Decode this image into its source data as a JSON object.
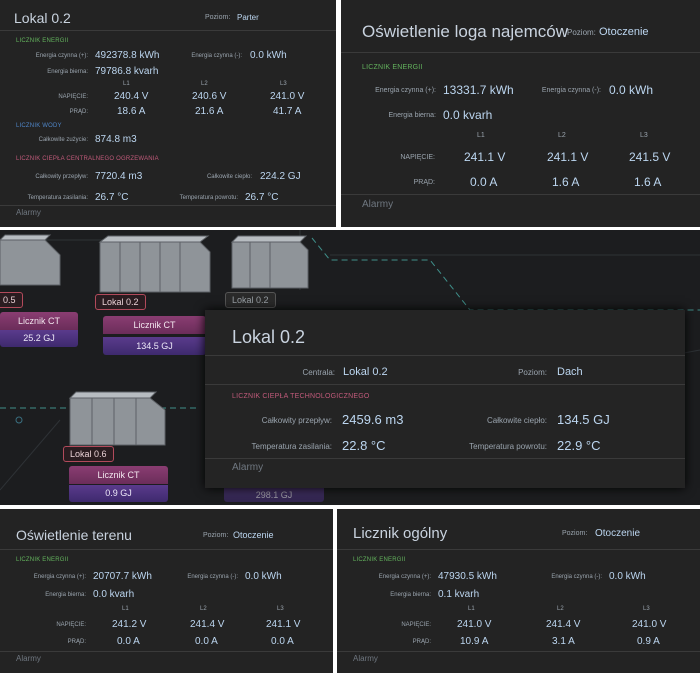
{
  "panel1": {
    "title": "Lokal 0.2",
    "poziom_label": "Poziom:",
    "poziom_value": "Parter",
    "energy_section": "LICZNIK ENERGII",
    "energia_czynna_plus_label": "Energia czynna (+):",
    "energia_czynna_plus_value": "492378.8 kWh",
    "energia_czynna_minus_label": "Energia czynna (-):",
    "energia_czynna_minus_value": "0.0 kWh",
    "energia_bierna_label": "Energia bierna:",
    "energia_bierna_value": "79786.8 kvarh",
    "l1": "L1",
    "l2": "L2",
    "l3": "L3",
    "napiecie_label": "NAPIĘCIE:",
    "napiecie": [
      "240.4 V",
      "240.6 V",
      "241.0 V"
    ],
    "prad_label": "PRĄD:",
    "prad": [
      "18.6 A",
      "21.6 A",
      "41.7 A"
    ],
    "water_section": "LICZNIK WODY",
    "zuzycie_label": "Całkowite zużycie:",
    "zuzycie_value": "874.8 m3",
    "heat_section": "LICZNIK CIEPŁA CENTRALNEGO OGRZEWANIA",
    "przeplyw_label": "Całkowity przepływ:",
    "przeplyw_value": "7720.4 m3",
    "cieplo_label": "Całkowite ciepło:",
    "cieplo_value": "224.2 GJ",
    "t_zasilania_label": "Temperatura zasilania:",
    "t_zasilania_value": "26.7 °C",
    "t_powrotu_label": "Temperatura powrotu:",
    "t_powrotu_value": "26.7 °C",
    "alarmy": "Alarmy"
  },
  "panel2": {
    "title": "Oświetlenie loga najemców",
    "poziom_label": "Poziom:",
    "poziom_value": "Otoczenie",
    "energy_section": "LICZNIK ENERGII",
    "energia_czynna_plus_label": "Energia czynna (+):",
    "energia_czynna_plus_value": "13331.7 kWh",
    "energia_czynna_minus_label": "Energia czynna (-):",
    "energia_czynna_minus_value": "0.0 kWh",
    "energia_bierna_label": "Energia bierna:",
    "energia_bierna_value": "0.0 kvarh",
    "l1": "L1",
    "l2": "L2",
    "l3": "L3",
    "napiecie_label": "NAPIĘCIE:",
    "napiecie": [
      "241.1 V",
      "241.1 V",
      "241.5 V"
    ],
    "prad_label": "PRĄD:",
    "prad": [
      "0.0 A",
      "1.6 A",
      "1.6 A"
    ],
    "alarmy": "Alarmy"
  },
  "scene": {
    "tag_a": "0.5",
    "tag_b": "Lokal 0.2",
    "tag_c": "Lokal 0.2",
    "tag_d": "Lokal 0.6",
    "ct1_label": "Licznik CT",
    "ct1_value": "25.2 GJ",
    "ct2_label": "Licznik CT",
    "ct2_value": "134.5 GJ",
    "ct3_label": "Licznik CT",
    "ct3_value": "0.9 GJ",
    "ct4_value": "298.1 GJ"
  },
  "popup": {
    "title": "Lokal 0.2",
    "centrala_label": "Centrala:",
    "centrala_value": "Lokal 0.2",
    "poziom_label": "Poziom:",
    "poziom_value": "Dach",
    "section": "LICZNIK CIEPŁA TECHNOLOGICZNEGO",
    "przeplyw_label": "Całkowity przepływ:",
    "przeplyw_value": "2459.6 m3",
    "cieplo_label": "Całkowite ciepło:",
    "cieplo_value": "134.5 GJ",
    "t_zasilania_label": "Temperatura zasilania:",
    "t_zasilania_value": "22.8 °C",
    "t_powrotu_label": "Temperatura powrotu:",
    "t_powrotu_value": "22.9 °C",
    "alarmy": "Alarmy"
  },
  "panel3": {
    "title": "Oświetlenie terenu",
    "poziom_label": "Poziom:",
    "poziom_value": "Otoczenie",
    "energy_section": "LICZNIK ENERGII",
    "energia_czynna_plus_label": "Energia czynna (+):",
    "energia_czynna_plus_value": "20707.7 kWh",
    "energia_czynna_minus_label": "Energia czynna (-):",
    "energia_czynna_minus_value": "0.0 kWh",
    "energia_bierna_label": "Energia bierna:",
    "energia_bierna_value": "0.0 kvarh",
    "l1": "L1",
    "l2": "L2",
    "l3": "L3",
    "napiecie_label": "NAPIĘCIE:",
    "napiecie": [
      "241.2 V",
      "241.4 V",
      "241.1 V"
    ],
    "prad_label": "PRĄD:",
    "prad": [
      "0.0 A",
      "0.0 A",
      "0.0 A"
    ],
    "alarmy": "Alarmy"
  },
  "panel4": {
    "title": "Licznik ogólny",
    "poziom_label": "Poziom:",
    "poziom_value": "Otoczenie",
    "energy_section": "LICZNIK ENERGII",
    "energia_czynna_plus_label": "Energia czynna (+):",
    "energia_czynna_plus_value": "47930.5 kWh",
    "energia_czynna_minus_label": "Energia czynna (-):",
    "energia_czynna_minus_value": "0.0 kWh",
    "energia_bierna_label": "Energia bierna:",
    "energia_bierna_value": "0.1 kvarh",
    "l1": "L1",
    "l2": "L2",
    "l3": "L3",
    "napiecie_label": "NAPIĘCIE:",
    "napiecie": [
      "241.0 V",
      "241.4 V",
      "241.0 V"
    ],
    "prad_label": "PRĄD:",
    "prad": [
      "10.9 A",
      "3.1 A",
      "0.9 A"
    ],
    "alarmy": "Alarmy"
  },
  "colors": {
    "panel_bg": "#232323",
    "section_green": "#63b35d",
    "section_blue": "#4f86c8",
    "section_pink": "#c05a7a",
    "value_blue": "#bcd6f0"
  }
}
